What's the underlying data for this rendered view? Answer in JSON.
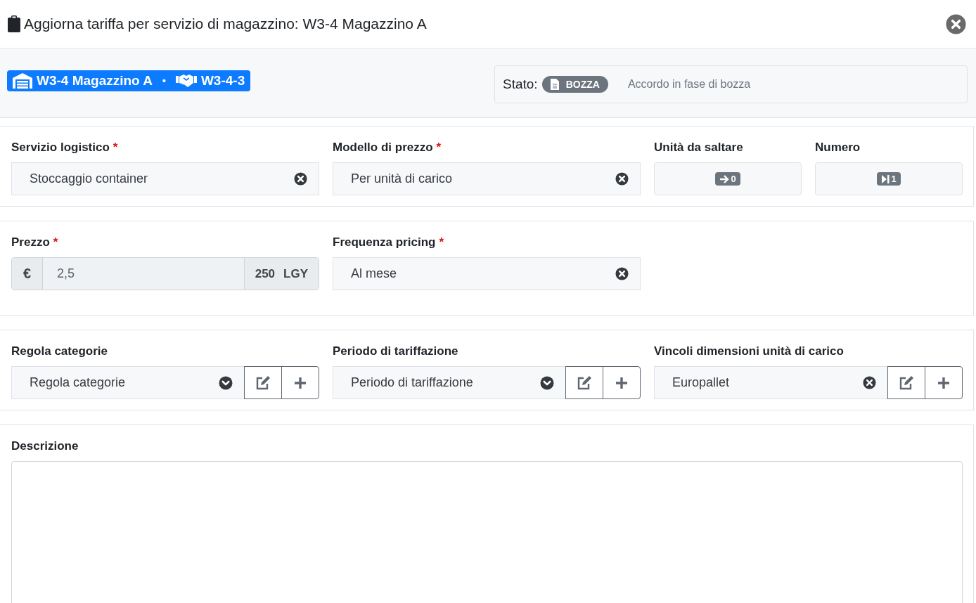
{
  "dialog": {
    "title": "Aggiorna tariffa per servizio di magazzino: W3-4 Magazzino A"
  },
  "context_badge": {
    "warehouse": "W3-4 Magazzino A",
    "separator": "•",
    "agreement": "W3-4-3"
  },
  "status": {
    "label": "Stato:",
    "badge": "BOZZA",
    "description": "Accordo in fase di bozza"
  },
  "sections": [
    {
      "fields": [
        {
          "kind": "select",
          "label": "Servizio logistico",
          "required_mark": "*",
          "value": "Stoccaggio container",
          "clearable": true,
          "actions": false
        },
        {
          "kind": "select",
          "label": "Modello di prezzo",
          "required_mark": "*",
          "value": "Per unità di carico",
          "clearable": true,
          "actions": false
        },
        {
          "kind": "skip",
          "label": "Unità da saltare",
          "value": "0"
        },
        {
          "kind": "number",
          "label": "Numero",
          "value": "1"
        }
      ]
    },
    {
      "fields": [
        {
          "kind": "price",
          "label": "Prezzo",
          "required_mark": "*",
          "currency": "€",
          "value": "2,5",
          "quantity": "250",
          "unit": "LGY"
        },
        {
          "kind": "select",
          "label": "Frequenza pricing",
          "required_mark": "*",
          "value": "Al mese",
          "clearable": true,
          "actions": false
        }
      ]
    },
    {
      "fields": [
        {
          "kind": "select",
          "label": "Regola categorie",
          "value": "Regola categorie",
          "clearable": false,
          "actions": true
        },
        {
          "kind": "select",
          "label": "Periodo di tariffazione",
          "value": "Periodo di tariffazione",
          "clearable": false,
          "actions": true
        },
        {
          "kind": "select",
          "label": "Vincoli dimensioni unità di carico",
          "value": "Europallet",
          "clearable": true,
          "actions": true
        }
      ]
    },
    {
      "fields": [
        {
          "kind": "textarea",
          "label": "Descrizione"
        }
      ]
    }
  ]
}
